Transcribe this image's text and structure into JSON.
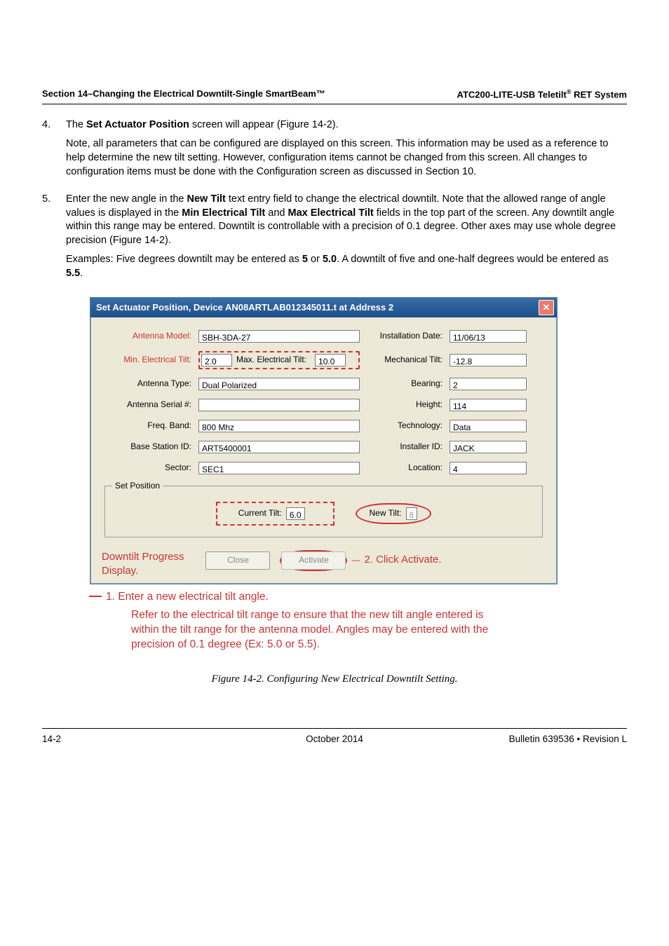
{
  "running_head": {
    "left": "Section 14–Changing the Electrical Downtilt-Single SmartBeam™",
    "right_prefix": "ATC200-LITE-USB Teletilt",
    "right_suffix": " RET System",
    "sup": "®"
  },
  "step4": {
    "num": "4.",
    "line1_a": "The ",
    "line1_bold": "Set Actuator Position",
    "line1_b": " screen will appear (Figure 14-2).",
    "line2": "Note, all parameters that can be configured are displayed on this screen. This information may be used as a reference to help determine the new tilt setting. However, configuration items cannot be changed from this screen. All changes to configuration items must be done with the Configuration screen as discussed in Section 10."
  },
  "step5": {
    "num": "5.",
    "line1_a": "Enter the new angle in the ",
    "bold1": "New Tilt",
    "line1_b": " text entry field to change the electrical downtilt. Note that the allowed range of angle values is displayed in the ",
    "bold2": "Min Electrical Tilt",
    "line1_c": " and ",
    "bold3": "Max Electrical Tilt",
    "line1_d": " fields in the top part of the screen. Any downtilt angle within this range may be entered. Downtilt is controllable with a precision of 0.1 degree. Other axes may use whole degree precision (Figure 14-2).",
    "examples_a": "Examples: Five degrees downtilt may be entered as ",
    "ex_b1": "5",
    "examples_b": " or ",
    "ex_b2": "5.0",
    "examples_c": ". A downtilt of five and one-half degrees would be entered as ",
    "ex_b3": "5.5",
    "examples_d": "."
  },
  "dialog": {
    "title": "Set Actuator Position, Device AN08ARTLAB012345011.t  at Address 2",
    "labels": {
      "antenna_model": "Antenna Model:",
      "install_date": "Installation Date:",
      "min_tilt": "Min. Electrical Tilt:",
      "max_tilt": "Max. Electrical Tilt:",
      "mech_tilt": "Mechanical Tilt:",
      "ant_type": "Antenna Type:",
      "bearing": "Bearing:",
      "serial": "Antenna Serial #:",
      "height": "Height:",
      "freq": "Freq. Band:",
      "tech": "Technology:",
      "bs_id": "Base Station ID:",
      "installer": "Installer ID:",
      "sector": "Sector:",
      "location": "Location:",
      "set_pos": "Set Position",
      "cur_tilt": "Current Tilt:",
      "new_tilt": "New Tilt:"
    },
    "values": {
      "antenna_model": "SBH-3DA-27",
      "install_date": "11/06/13",
      "min_tilt": "2.0",
      "max_tilt": "10.0",
      "mech_tilt": "-12.8",
      "ant_type": "Dual Polarized",
      "bearing": "2",
      "serial": "",
      "height": "114",
      "freq": " 800  Mhz",
      "tech": "Data",
      "bs_id": "ART5400001",
      "installer": "JACK",
      "sector": "SEC1",
      "location": "4",
      "cur_tilt": "6.0",
      "new_tilt": "8"
    },
    "buttons": {
      "close": "Close",
      "activate": "Activate"
    },
    "callouts": {
      "progress": "Downtilt Progress Display.",
      "click_activate": "2. Click Activate."
    }
  },
  "notes": {
    "n1": "1.   Enter a new electrical tilt angle.",
    "n2": "Refer to the electrical tilt range to ensure that the new tilt angle entered is within the tilt range for the antenna model. Angles may be entered with the precision of 0.1 degree (Ex: 5.0 or 5.5)."
  },
  "fig_caption": "Figure 14-2. Configuring New Electrical Downtilt Setting.",
  "footer": {
    "left": "14-2",
    "center": "October 2014",
    "right": "Bulletin 639536  •  Revision L"
  }
}
